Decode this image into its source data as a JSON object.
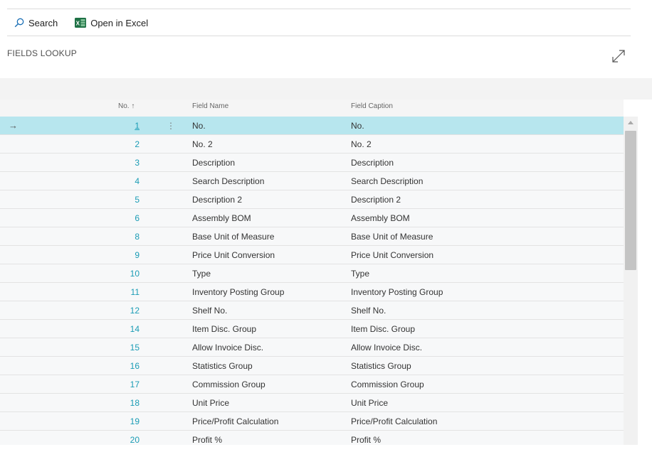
{
  "toolbar": {
    "search_label": "Search",
    "excel_label": "Open in Excel"
  },
  "page": {
    "title": "FIELDS LOOKUP"
  },
  "table": {
    "headers": {
      "no": "No. ↑",
      "field_name": "Field Name",
      "field_caption": "Field Caption"
    },
    "rows": [
      {
        "no": "1",
        "name": "No.",
        "caption": "No."
      },
      {
        "no": "2",
        "name": "No. 2",
        "caption": "No. 2"
      },
      {
        "no": "3",
        "name": "Description",
        "caption": "Description"
      },
      {
        "no": "4",
        "name": "Search Description",
        "caption": "Search Description"
      },
      {
        "no": "5",
        "name": "Description 2",
        "caption": "Description 2"
      },
      {
        "no": "6",
        "name": "Assembly BOM",
        "caption": "Assembly BOM"
      },
      {
        "no": "8",
        "name": "Base Unit of Measure",
        "caption": "Base Unit of Measure"
      },
      {
        "no": "9",
        "name": "Price Unit Conversion",
        "caption": "Price Unit Conversion"
      },
      {
        "no": "10",
        "name": "Type",
        "caption": "Type"
      },
      {
        "no": "11",
        "name": "Inventory Posting Group",
        "caption": "Inventory Posting Group"
      },
      {
        "no": "12",
        "name": "Shelf No.",
        "caption": "Shelf No."
      },
      {
        "no": "14",
        "name": "Item Disc. Group",
        "caption": "Item Disc. Group"
      },
      {
        "no": "15",
        "name": "Allow Invoice Disc.",
        "caption": "Allow Invoice Disc."
      },
      {
        "no": "16",
        "name": "Statistics Group",
        "caption": "Statistics Group"
      },
      {
        "no": "17",
        "name": "Commission Group",
        "caption": "Commission Group"
      },
      {
        "no": "18",
        "name": "Unit Price",
        "caption": "Unit Price"
      },
      {
        "no": "19",
        "name": "Price/Profit Calculation",
        "caption": "Price/Profit Calculation"
      },
      {
        "no": "20",
        "name": "Profit %",
        "caption": "Profit %"
      }
    ],
    "selected_row_marker": "→",
    "row_menu_glyph": "⋮"
  },
  "colors": {
    "selected_row": "#b7e6ee",
    "link": "#1a9cb5",
    "excel_green": "#1e7145"
  },
  "icons": {
    "search": "search-icon",
    "excel": "excel-icon",
    "expand": "expand-icon",
    "scroll_up": "scroll-up-arrow-icon"
  }
}
